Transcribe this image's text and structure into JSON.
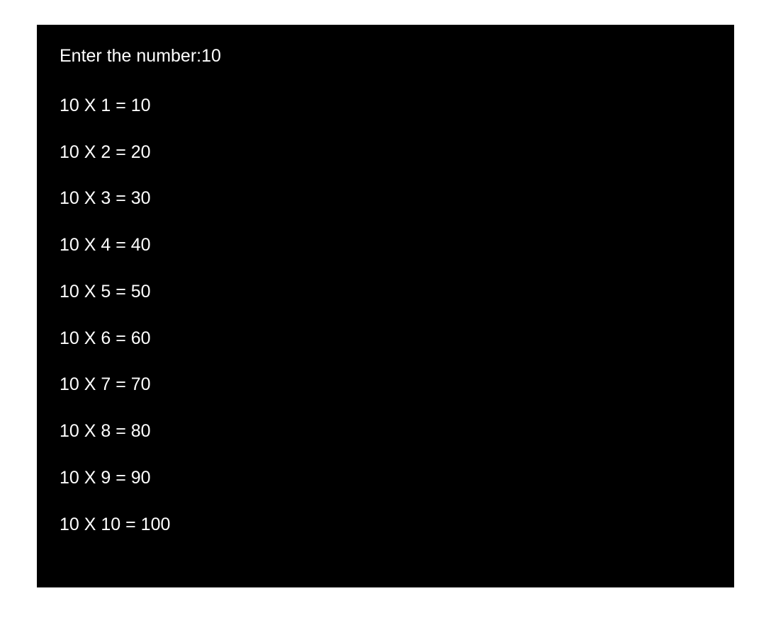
{
  "console": {
    "prompt": "Enter the number:",
    "input": "10",
    "lines": [
      "10 X 1 = 10",
      "10 X 2 = 20",
      "10 X 3 = 30",
      "10 X 4 = 40",
      "10 X 5 = 50",
      "10 X 6 = 60",
      "10 X 7 = 70",
      "10 X 8 = 80",
      "10 X 9 = 90",
      "10 X 10 = 100"
    ]
  }
}
